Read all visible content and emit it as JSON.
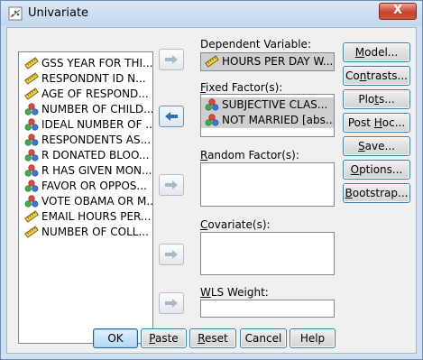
{
  "window": {
    "title": "Univariate",
    "close_label": "X"
  },
  "source_list": {
    "items": [
      {
        "label": "GSS YEAR FOR THI...",
        "type": "scale"
      },
      {
        "label": "RESPONDNT ID N...",
        "type": "scale"
      },
      {
        "label": "AGE OF RESPOND...",
        "type": "scale"
      },
      {
        "label": "NUMBER OF CHILD...",
        "type": "nominal"
      },
      {
        "label": "IDEAL NUMBER OF ...",
        "type": "nominal"
      },
      {
        "label": "RESPONDENTS AS...",
        "type": "nominal"
      },
      {
        "label": "R DONATED BLOO...",
        "type": "nominal"
      },
      {
        "label": "R HAS GIVEN MON...",
        "type": "nominal"
      },
      {
        "label": "FAVOR OR OPPOS...",
        "type": "nominal"
      },
      {
        "label": "VOTE OBAMA OR M...",
        "type": "nominal"
      },
      {
        "label": "EMAIL HOURS PER...",
        "type": "scale"
      },
      {
        "label": "NUMBER OF COLL...",
        "type": "scale"
      }
    ]
  },
  "dependent": {
    "label": "Dependent Variable:",
    "value": "HOURS PER DAY W..."
  },
  "fixed_factors": {
    "label_pre": "",
    "label_key": "F",
    "label_post": "ixed Factor(s):",
    "items": [
      {
        "label": "SUBJECTIVE CLAS..."
      },
      {
        "label": "NOT MARRIED [abs..."
      }
    ]
  },
  "random_factors": {
    "label_pre": "",
    "label_key": "R",
    "label_post": "andom Factor(s):"
  },
  "covariates": {
    "label_pre": "",
    "label_key": "C",
    "label_post": "ovariate(s):"
  },
  "wls": {
    "label_pre": "",
    "label_key": "W",
    "label_post": "LS Weight:",
    "value": ""
  },
  "right_buttons": {
    "model": {
      "pre": "",
      "key": "M",
      "post": "odel..."
    },
    "contrasts": {
      "pre": "Co",
      "key": "n",
      "post": "trasts..."
    },
    "plots": {
      "pre": "Plo",
      "key": "t",
      "post": "s..."
    },
    "posthoc": {
      "pre": "Post ",
      "key": "H",
      "post": "oc..."
    },
    "save": {
      "pre": "",
      "key": "S",
      "post": "ave..."
    },
    "options": {
      "pre": "",
      "key": "O",
      "post": "ptions..."
    },
    "bootstrap": {
      "pre": "",
      "key": "B",
      "post": "ootstrap..."
    }
  },
  "bottom_buttons": {
    "ok": {
      "pre": "OK",
      "key": "",
      "post": ""
    },
    "paste": {
      "pre": "",
      "key": "P",
      "post": "aste"
    },
    "reset": {
      "pre": "",
      "key": "R",
      "post": "eset"
    },
    "cancel": {
      "pre": "Cancel",
      "key": "",
      "post": ""
    },
    "help": {
      "pre": "Help",
      "key": "",
      "post": ""
    }
  }
}
